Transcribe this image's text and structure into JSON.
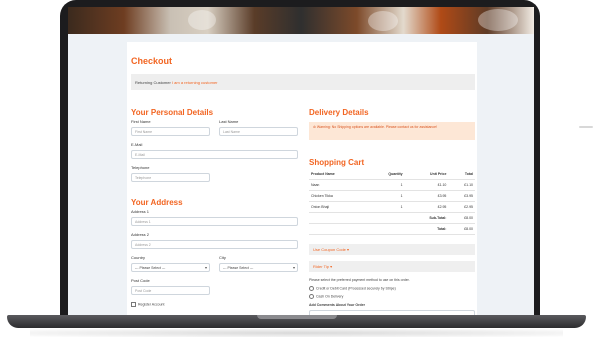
{
  "checkout": {
    "title": "Checkout",
    "returning_prefix": "Returning Customer",
    "returning_link": "I am a returning customer"
  },
  "personal": {
    "title": "Your Personal Details",
    "first_name_label": "First Name",
    "first_name_placeholder": "First Name",
    "last_name_label": "Last Name",
    "last_name_placeholder": "Last Name",
    "email_label": "E-Mail",
    "email_placeholder": "E-Mail",
    "telephone_label": "Telephone",
    "telephone_placeholder": "Telephone"
  },
  "address": {
    "title": "Your Address",
    "address1_label": "Address 1",
    "address1_placeholder": "Address 1",
    "address2_label": "Address 2",
    "address2_placeholder": "Address 2",
    "country_label": "Country",
    "country_value": "--- Please Select ---",
    "city_label": "City",
    "city_value": "--- Please Select ---",
    "post_code_label": "Post Code",
    "post_code_placeholder": "Post Code",
    "register_label": "Register Account"
  },
  "delivery": {
    "title": "Delivery Details",
    "warning": "Warning: No Shipping options are available. Please contact us for assistance!"
  },
  "cart": {
    "title": "Shopping Cart",
    "headers": [
      "Product Name",
      "Quantity",
      "Unit Price",
      "Total"
    ],
    "rows": [
      {
        "name": "Naan",
        "qty": "1",
        "unit": "£1.10",
        "total": "£1.10"
      },
      {
        "name": "Chicken Tikka",
        "qty": "1",
        "unit": "£3.95",
        "total": "£3.95"
      },
      {
        "name": "Onion Bhaji",
        "qty": "1",
        "unit": "£2.95",
        "total": "£2.95"
      }
    ],
    "subtotal_label": "Sub-Total:",
    "subtotal_value": "£8.00",
    "total_label": "Total:",
    "total_value": "£8.00"
  },
  "coupon": {
    "label": "Use Coupon Code ▾"
  },
  "tip": {
    "label": "Rider Tip ▾"
  },
  "payment": {
    "instruction": "Please select the preferred payment method to use on this order.",
    "option_card": "Credit or Debit Card (Processed securely by Stripe)",
    "option_cash": "Cash On Delivery"
  },
  "comments": {
    "label": "Add Comments About Your Order"
  }
}
